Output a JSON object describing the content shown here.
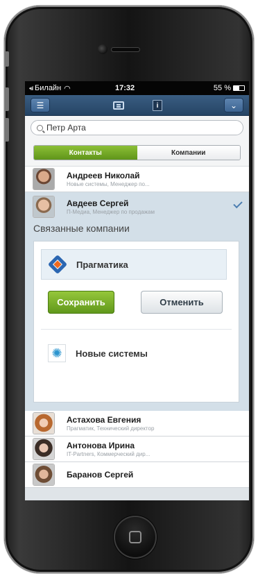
{
  "status_bar": {
    "signal": "•ııl",
    "carrier": "Билайн",
    "wifi_icon": "wifi-icon",
    "time": "17:32",
    "battery": "55 %",
    "battery_level": 0.55
  },
  "nav_bar": {
    "menu_icon": "menu-icon",
    "chat_icon": "chat-icon",
    "info_glyph": "i",
    "dropdown_icon": "chevron-down-icon"
  },
  "search": {
    "value": "Петр Арта"
  },
  "segments": {
    "contacts": "Контакты",
    "companies": "Компании",
    "active": "contacts"
  },
  "contacts_top": [
    {
      "name": "Андреев Николай",
      "subtitle": "Новые системы, Менеджер по..."
    },
    {
      "name": "Авдеев Сергей",
      "subtitle": "П-Медиа, Менеджер по продажам",
      "selected": true
    }
  ],
  "related": {
    "title": "Связанные компании",
    "companies": [
      {
        "name": "Прагматика",
        "logo": "pragmatika-logo"
      },
      {
        "name": "Новые системы",
        "logo": "novye-sistemy-logo",
        "logo_glyph": "✺"
      }
    ],
    "save_label": "Сохранить",
    "cancel_label": "Отменить"
  },
  "contacts_bottom": [
    {
      "name": "Астахова Евгения",
      "subtitle": "Прагматик, Технический директор"
    },
    {
      "name": "Антонова Ирина",
      "subtitle": "IT-Partners, Коммерческий дир..."
    },
    {
      "name": "Баранов Сергей",
      "subtitle": ""
    }
  ],
  "colors": {
    "nav_bar": "#2f5072",
    "accent_green": "#7ab12b",
    "selected_row": "#d3dfe8",
    "check": "#4d7fb1"
  }
}
